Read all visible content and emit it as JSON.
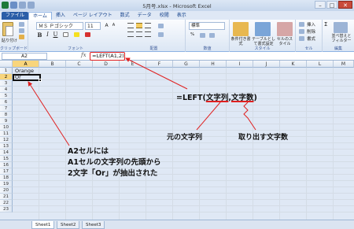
{
  "window": {
    "title": "5月号.xlsx - Microsoft Excel"
  },
  "ribbon_tabs": [
    "ファイル",
    "ホーム",
    "挿入",
    "ページ レイアウト",
    "数式",
    "データ",
    "校閲",
    "表示"
  ],
  "ribbon": {
    "clipboard": {
      "paste_label": "貼り付け",
      "group_label": "クリップボード"
    },
    "font": {
      "name": "ＭＳ Ｐゴシック",
      "size": "11",
      "group_label": "フォント",
      "bold": "B",
      "italic": "I",
      "underline": "U",
      "grow": "A",
      "shrink": "A"
    },
    "alignment": {
      "group_label": "配置"
    },
    "number": {
      "format": "標準",
      "group_label": "数値",
      "percent": "%"
    },
    "styles": {
      "cond_format": "条件付き書式",
      "table_format": "テーブルとして書式設定",
      "cell_styles": "セルのスタイル",
      "group_label": "スタイル"
    },
    "cells": {
      "insert": "挿入",
      "delete": "削除",
      "format": "書式",
      "group_label": "セル"
    },
    "editing": {
      "sum": "Σ",
      "sort_filter": "並べ替えとフィルター",
      "group_label": "編集"
    }
  },
  "formula_bar": {
    "name_box": "A2",
    "fx": "fx",
    "formula": "=LEFT(A1,2)"
  },
  "columns": [
    "A",
    "B",
    "C",
    "D",
    "E",
    "F",
    "G",
    "H",
    "I",
    "J",
    "K",
    "L",
    "M"
  ],
  "rows": [
    "1",
    "2",
    "3",
    "4",
    "5",
    "6",
    "7",
    "8",
    "9",
    "10",
    "11",
    "12",
    "13",
    "14",
    "15",
    "16",
    "17",
    "18",
    "19",
    "20",
    "21",
    "22",
    "23"
  ],
  "cells": {
    "A1": "Orange",
    "A2": "Or"
  },
  "annotations": {
    "formula_prefix": "=LEFT(",
    "arg1": "文字列",
    "comma": ",",
    "arg2": "文字数",
    "formula_suffix": ")",
    "label_source": "元の文字列",
    "label_count": "取り出す文字数",
    "explain_line1": "A2セルには",
    "explain_line2": "A1セルの文字列の先頭から",
    "explain_line3": "2文字「Or」が抽出された"
  },
  "colors": {
    "accent_red": "#e02020",
    "selection": "#f8d57c",
    "file_tab": "#2a5ea8"
  },
  "sheet_tabs": [
    "Sheet1",
    "Sheet2",
    "Sheet3"
  ]
}
